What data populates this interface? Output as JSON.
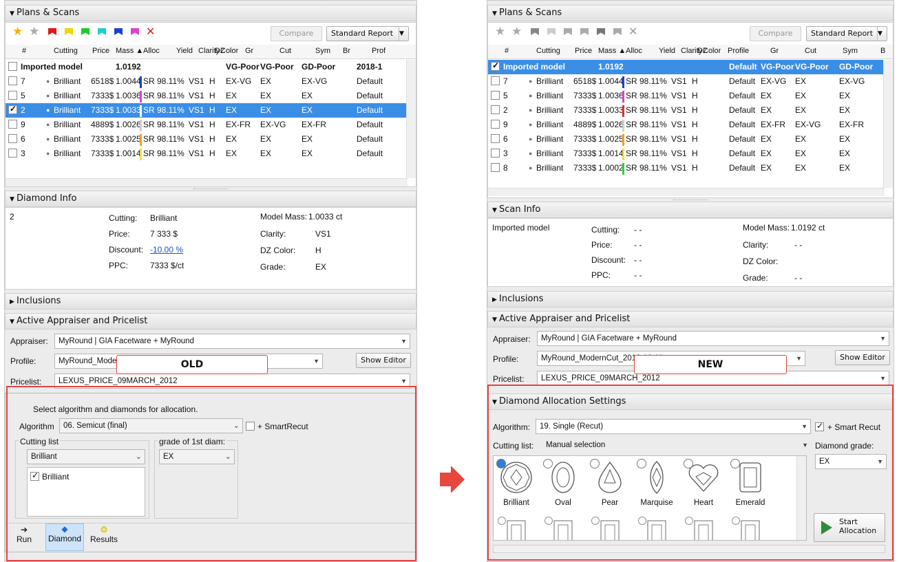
{
  "left": {
    "plans_title": "Plans & Scans",
    "compare": "Compare",
    "standard_report": "Standard Report",
    "columns": [
      "#",
      "Cutting",
      "Price",
      "Mass ▲",
      "Alloc",
      "Yield",
      "Clarity",
      "DZ",
      "Color",
      "Gr",
      "Cut",
      "Sym",
      "Br",
      "Prof"
    ],
    "rows": [
      {
        "num": "Imported model",
        "mass": "1.0192",
        "gr": "VG-Poor",
        "cut": "VG-Poor",
        "sym": "GD-Poor",
        "prof": "2018-1",
        "bold": true
      },
      {
        "num": "7",
        "cutting": "Brilliant",
        "price": "6518$",
        "mass": "1.0044",
        "alloc": "SR",
        "yield": "98.11%",
        "clarity": "VS1",
        "color": "H",
        "gr": "EX-VG",
        "cut": "EX",
        "sym": "EX-VG",
        "prof": "Default",
        "bar": "#1d3fd6"
      },
      {
        "num": "5",
        "cutting": "Brilliant",
        "price": "7333$",
        "mass": "1.0036",
        "alloc": "SR",
        "yield": "98.11%",
        "clarity": "VS1",
        "color": "H",
        "gr": "EX",
        "cut": "EX",
        "sym": "EX",
        "prof": "Default",
        "bar": "#e040d0"
      },
      {
        "num": "2",
        "cutting": "Brilliant",
        "price": "7333$",
        "mass": "1.0033",
        "alloc": "SR",
        "yield": "98.11%",
        "clarity": "VS1",
        "color": "H",
        "gr": "EX",
        "cut": "EX",
        "sym": "EX",
        "prof": "Default",
        "bar": "#ffffff",
        "selected": true,
        "checked": true
      },
      {
        "num": "9",
        "cutting": "Brilliant",
        "price": "4889$",
        "mass": "1.0026",
        "alloc": "SR",
        "yield": "98.11%",
        "clarity": "VS1",
        "color": "H",
        "gr": "EX-FR",
        "cut": "EX-VG",
        "sym": "EX-FR",
        "prof": "Default",
        "bar": "#d0d0d0"
      },
      {
        "num": "6",
        "cutting": "Brilliant",
        "price": "7333$",
        "mass": "1.0025",
        "alloc": "SR",
        "yield": "98.11%",
        "clarity": "VS1",
        "color": "H",
        "gr": "EX",
        "cut": "EX",
        "sym": "EX",
        "prof": "Default",
        "bar": "#f0a020"
      },
      {
        "num": "3",
        "cutting": "Brilliant",
        "price": "7333$",
        "mass": "1.0014",
        "alloc": "SR",
        "yield": "98.11%",
        "clarity": "VS1",
        "color": "H",
        "gr": "EX",
        "cut": "EX",
        "sym": "EX",
        "prof": "Default",
        "bar": "#f0e040"
      }
    ],
    "diamond_info_title": "Diamond Info",
    "info_id": "2",
    "cutting_l": "Cutting:",
    "cutting_v": "Brilliant",
    "price_l": "Price:",
    "price_v": "7 333 $",
    "discount_l": "Discount:",
    "discount_v": "-10.00 %",
    "ppc_l": "PPC:",
    "ppc_v": "7333 $/ct",
    "mass_l": "Model Mass:",
    "mass_v": "1.0033 ct",
    "clarity_l": "Clarity:",
    "clarity_v": "VS1",
    "dzcolor_l": "DZ Color:",
    "dzcolor_v": "H",
    "grade_l": "Grade:",
    "grade_v": "EX",
    "inclusions_title": "Inclusions",
    "appraiser_title": "Active Appraiser and Pricelist",
    "appraiser_l": "Appraiser:",
    "appraiser_v": "MyRound | GIA Facetware + MyRound",
    "profile_l": "Profile:",
    "profile_v": "MyRound_Mode",
    "show_editor": "Show Editor",
    "pricelist_l": "Pricelist:",
    "pricelist_v": "LEXUS_PRICE_09MARCH_2012",
    "tag": "OLD",
    "alloc_hint": "Select algorithm and diamonds for allocation.",
    "algorithm_l": "Algorithm",
    "algorithm_v": "06. Semicut (final)",
    "smartrecut": "+ SmartRecut",
    "cutting_list_l": "Cutting list",
    "cutting_list_v": "Brilliant",
    "grade_first_l": "grade of 1st diam:",
    "grade_first_v": "EX",
    "brilliant_item": "Brilliant",
    "tab_run": "Run",
    "tab_diamond": "Diamond",
    "tab_results": "Results"
  },
  "right": {
    "plans_title": "Plans & Scans",
    "compare": "Compare",
    "standard_report": "Standard Report",
    "columns": [
      "#",
      "Cutting",
      "Price",
      "Mass ▲",
      "Alloc",
      "Yield",
      "Clarity",
      "DZ",
      "Color",
      "Profile",
      "Gr",
      "Cut",
      "Sym",
      "B"
    ],
    "rows": [
      {
        "num": "Imported model",
        "mass": "1.0192",
        "prof": "Default",
        "gr": "VG-Poor",
        "cut": "VG-Poor",
        "sym": "GD-Poor",
        "bold": true,
        "selected": true,
        "checked": true
      },
      {
        "num": "7",
        "cutting": "Brilliant",
        "price": "6518$",
        "mass": "1.0044",
        "alloc": "SR",
        "yield": "98.11%",
        "clarity": "VS1",
        "color": "H",
        "prof": "Default",
        "gr": "EX-VG",
        "cut": "EX",
        "sym": "EX-VG",
        "bar": "#1d3fd6"
      },
      {
        "num": "5",
        "cutting": "Brilliant",
        "price": "7333$",
        "mass": "1.0036",
        "alloc": "SR",
        "yield": "98.11%",
        "clarity": "VS1",
        "color": "H",
        "prof": "Default",
        "gr": "EX",
        "cut": "EX",
        "sym": "EX",
        "bar": "#e040d0"
      },
      {
        "num": "2",
        "cutting": "Brilliant",
        "price": "7333$",
        "mass": "1.0033",
        "alloc": "SR",
        "yield": "98.11%",
        "clarity": "VS1",
        "color": "H",
        "prof": "Default",
        "gr": "EX",
        "cut": "EX",
        "sym": "EX",
        "bar": "#e03030"
      },
      {
        "num": "9",
        "cutting": "Brilliant",
        "price": "4889$",
        "mass": "1.0026",
        "alloc": "SR",
        "yield": "98.11%",
        "clarity": "VS1",
        "color": "H",
        "prof": "Default",
        "gr": "EX-FR",
        "cut": "EX-VG",
        "sym": "EX-FR",
        "bar": "#d0d0d0"
      },
      {
        "num": "6",
        "cutting": "Brilliant",
        "price": "7333$",
        "mass": "1.0025",
        "alloc": "SR",
        "yield": "98.11%",
        "clarity": "VS1",
        "color": "H",
        "prof": "Default",
        "gr": "EX",
        "cut": "EX",
        "sym": "EX",
        "bar": "#f0a020"
      },
      {
        "num": "3",
        "cutting": "Brilliant",
        "price": "7333$",
        "mass": "1.0014",
        "alloc": "SR",
        "yield": "98.11%",
        "clarity": "VS1",
        "color": "H",
        "prof": "Default",
        "gr": "EX",
        "cut": "EX",
        "sym": "EX",
        "bar": "#f0e040"
      },
      {
        "num": "8",
        "cutting": "Brilliant",
        "price": "7333$",
        "mass": "1.0002",
        "alloc": "SR",
        "yield": "98.11%",
        "clarity": "VS1",
        "color": "H",
        "prof": "Default",
        "gr": "EX",
        "cut": "EX",
        "sym": "EX",
        "bar": "#30d040"
      }
    ],
    "scan_info_title": "Scan Info",
    "info_id": "Imported model",
    "cutting_l": "Cutting:",
    "cutting_v": "- -",
    "price_l": "Price:",
    "price_v": "- -",
    "discount_l": "Discount:",
    "discount_v": "- -",
    "ppc_l": "PPC:",
    "ppc_v": "- -",
    "mass_l": "Model Mass:",
    "mass_v": "1.0192 ct",
    "clarity_l": "Clarity:",
    "clarity_v": "- -",
    "dzcolor_l": "DZ Color:",
    "dzcolor_v": "",
    "grade_l": "Grade:",
    "grade_v": "- -",
    "inclusions_title": "Inclusions",
    "appraiser_title": "Active Appraiser and Pricelist",
    "appraiser_l": "Appraiser:",
    "appraiser_v": "MyRound | GIA Facetware + MyRound",
    "profile_l": "Profile:",
    "profile_v": "MyRound_ModernCut_2018-10-11",
    "show_editor": "Show Editor",
    "pricelist_l": "Pricelist:",
    "pricelist_v": "LEXUS_PRICE_09MARCH_2012",
    "tag": "NEW",
    "alloc_title": "Diamond Allocation Settings",
    "algorithm_l": "Algorithm:",
    "algorithm_v": "19. Single (Recut)",
    "smartrecut": "+ Smart Recut",
    "cutting_list_l": "Cutting list:",
    "cutting_list_v": "Manual selection",
    "grade_l2": "Diamond grade:",
    "grade_v2": "EX",
    "shapes": [
      "Brilliant",
      "Oval",
      "Pear",
      "Marquise",
      "Heart",
      "Emerald"
    ],
    "start_allocation": "Start Allocation"
  },
  "colors": {
    "selection": "#3a8ee6",
    "highlight": "#e14545",
    "link": "#1a55c8"
  }
}
